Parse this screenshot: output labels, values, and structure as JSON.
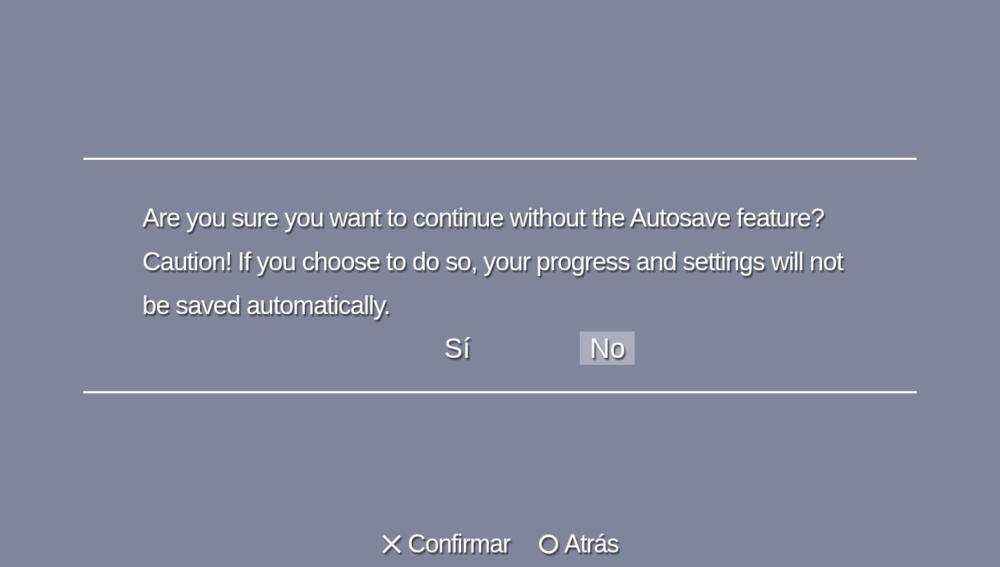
{
  "dialog": {
    "message": "Are you sure you want to continue without the Autosave feature? Caution! If you choose to do so, your progress and settings will not be saved automatically.",
    "options": [
      {
        "label": "Sí",
        "selected": false
      },
      {
        "label": "No",
        "selected": true
      }
    ]
  },
  "button_hints": [
    {
      "kind": "cross",
      "label": "Confirmar"
    },
    {
      "kind": "circle",
      "label": "Atrás"
    }
  ]
}
